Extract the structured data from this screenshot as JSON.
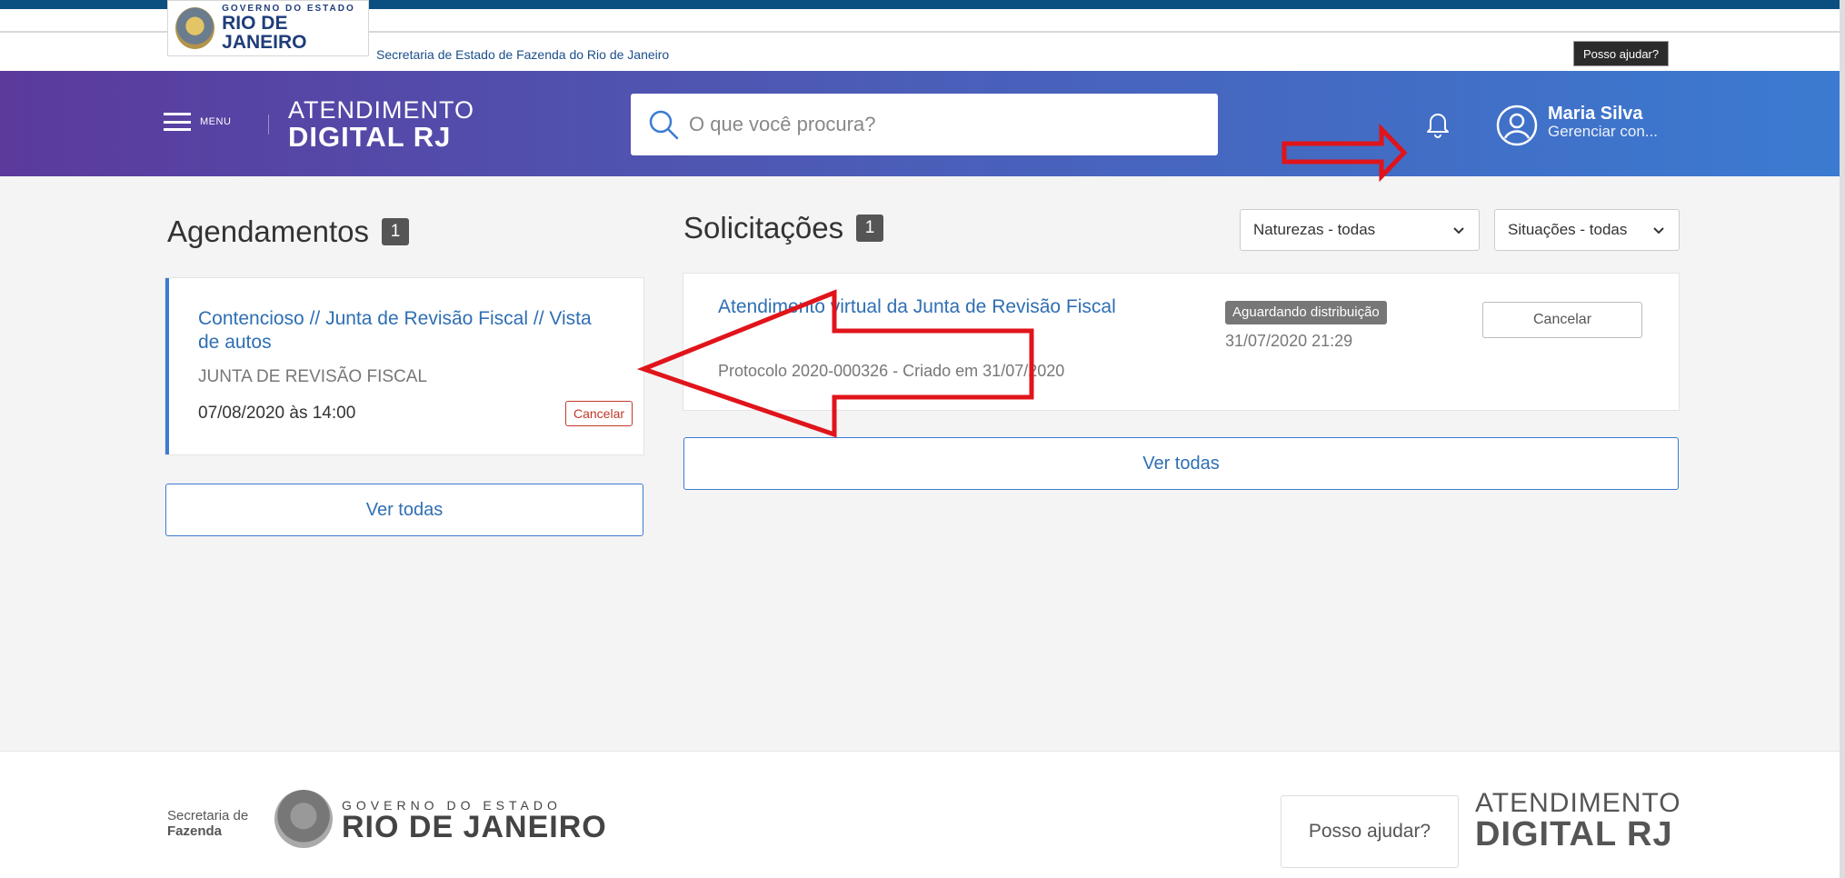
{
  "gov": {
    "small": "GOVERNO DO ESTADO",
    "big": "RIO DE JANEIRO",
    "secretaria": "Secretaria de Estado de Fazenda do Rio de Janeiro",
    "help": "Posso ajudar?"
  },
  "header": {
    "menu_label": "MENU",
    "brand_line1": "ATENDIMENTO",
    "brand_line2": "DIGITAL RJ",
    "search_placeholder": "O que você procura?",
    "user_name": "Maria Silva",
    "user_sub": "Gerenciar con..."
  },
  "agendamentos": {
    "title": "Agendamentos",
    "count": "1",
    "items": [
      {
        "title": "Contencioso // Junta de Revisão Fiscal // Vista de autos",
        "org": "JUNTA DE REVISÃO FISCAL",
        "datetime": "07/08/2020 às 14:00",
        "cancel": "Cancelar"
      }
    ],
    "see_all": "Ver todas"
  },
  "solicitacoes": {
    "title": "Solicitações",
    "count": "1",
    "filter_natureza": "Naturezas - todas",
    "filter_situacao": "Situações - todas",
    "items": [
      {
        "title": "Atendimento virtual da Junta de Revisão Fiscal",
        "protocol": "Protocolo 2020-000326 - Criado em 31/07/2020",
        "status": "Aguardando distribuição",
        "date": "31/07/2020 21:29",
        "cancel": "Cancelar"
      }
    ],
    "see_all": "Ver todas"
  },
  "footer": {
    "secretaria_line1": "Secretaria de",
    "secretaria_line2": "Fazenda",
    "gov_small": "GOVERNO DO ESTADO",
    "gov_big": "RIO DE JANEIRO",
    "help": "Posso ajudar?",
    "brand_line1": "ATENDIMENTO",
    "brand_line2": "DIGITAL RJ"
  },
  "colors": {
    "primary": "#3b7bd1",
    "header_start": "#5b3a9c",
    "header_end": "#3b7bd1",
    "annotation": "#e0141b"
  }
}
